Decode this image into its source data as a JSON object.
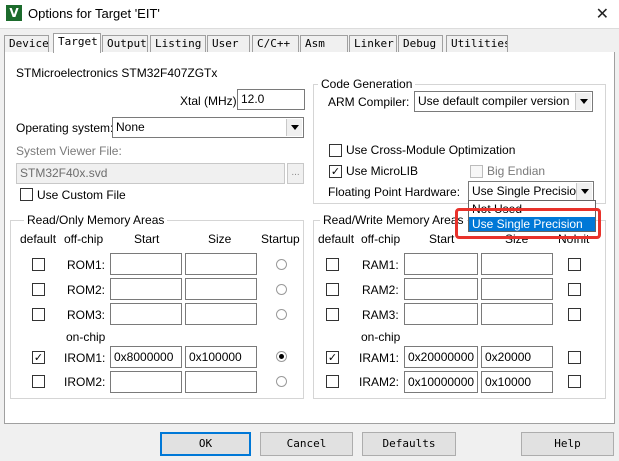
{
  "window": {
    "title": "Options for Target 'EIT'",
    "app_icon_glyph": "V",
    "close_glyph": "✕"
  },
  "tabs": [
    {
      "label": "Device"
    },
    {
      "label": "Target",
      "active": true
    },
    {
      "label": "Output"
    },
    {
      "label": "Listing"
    },
    {
      "label": "User"
    },
    {
      "label": "C/C++"
    },
    {
      "label": "Asm"
    },
    {
      "label": "Linker"
    },
    {
      "label": "Debug"
    },
    {
      "label": "Utilities"
    }
  ],
  "target": {
    "device_name": "STMicroelectronics STM32F407ZGTx",
    "xtal_label": "Xtal (MHz):",
    "xtal_value": "12.0",
    "os_label": "Operating system:",
    "os_value": "None",
    "svd_label": "System Viewer File:",
    "svd_value": "STM32F40x.svd",
    "svd_browse": "...",
    "custom_file_label": "Use Custom File",
    "custom_file_checked": false
  },
  "code_gen": {
    "title": "Code Generation",
    "arm_compiler_label": "ARM Compiler:",
    "arm_compiler_value": "Use default compiler version",
    "cross_module_label": "Use Cross-Module Optimization",
    "cross_module_checked": false,
    "microlib_label": "Use MicroLIB",
    "microlib_checked": true,
    "big_endian_label": "Big Endian",
    "big_endian_checked": false,
    "fpu_label": "Floating Point Hardware:",
    "fpu_value": "Use Single Precision",
    "fpu_options": [
      "Not Used",
      "Use Single Precision"
    ],
    "fpu_highlight_color": "#e8322b"
  },
  "ro_memory": {
    "title": "Read/Only Memory Areas",
    "headers": {
      "default": "default",
      "offchip": "off-chip",
      "start": "Start",
      "size": "Size",
      "startup": "Startup"
    },
    "onchip_label": "on-chip",
    "rows": [
      {
        "name": "ROM1:",
        "default": false,
        "start": "",
        "size": "",
        "startup": false
      },
      {
        "name": "ROM2:",
        "default": false,
        "start": "",
        "size": "",
        "startup": false
      },
      {
        "name": "ROM3:",
        "default": false,
        "start": "",
        "size": "",
        "startup": false
      },
      {
        "name": "IROM1:",
        "default": true,
        "start": "0x8000000",
        "size": "0x100000",
        "startup": true
      },
      {
        "name": "IROM2:",
        "default": false,
        "start": "",
        "size": "",
        "startup": false
      }
    ]
  },
  "rw_memory": {
    "title": "Read/Write Memory Areas",
    "headers": {
      "default": "default",
      "offchip": "off-chip",
      "start": "Start",
      "size": "Size",
      "noinit": "NoInit"
    },
    "onchip_label": "on-chip",
    "rows": [
      {
        "name": "RAM1:",
        "default": false,
        "start": "",
        "size": "",
        "noinit": false
      },
      {
        "name": "RAM2:",
        "default": false,
        "start": "",
        "size": "",
        "noinit": false
      },
      {
        "name": "RAM3:",
        "default": false,
        "start": "",
        "size": "",
        "noinit": false
      },
      {
        "name": "IRAM1:",
        "default": true,
        "start": "0x20000000",
        "size": "0x20000",
        "noinit": false
      },
      {
        "name": "IRAM2:",
        "default": false,
        "start": "0x10000000",
        "size": "0x10000",
        "noinit": false
      }
    ]
  },
  "buttons": {
    "ok": "OK",
    "cancel": "Cancel",
    "defaults": "Defaults",
    "help": "Help"
  },
  "check_glyph": "✓"
}
